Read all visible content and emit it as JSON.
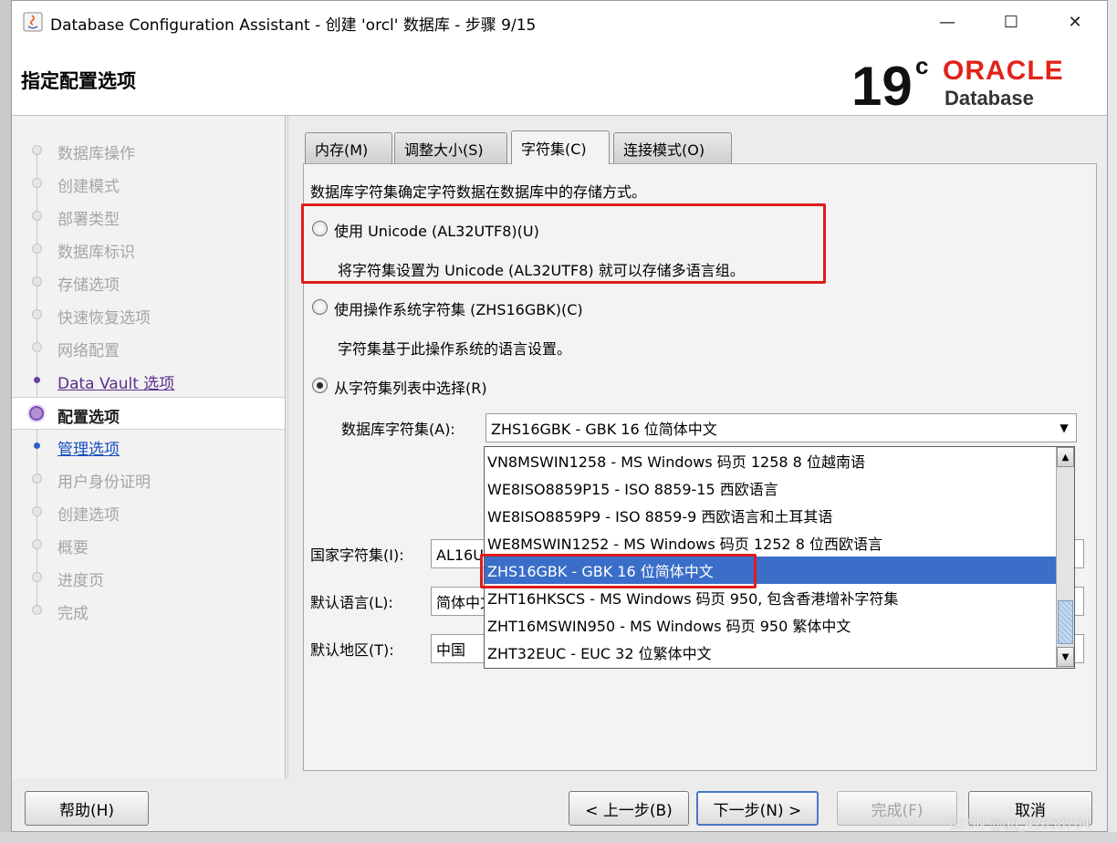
{
  "window": {
    "title": "Database Configuration Assistant - 创建 'orcl' 数据库 - 步骤 9/15",
    "controls": {
      "minimize": "—",
      "maximize": "☐",
      "close": "✕"
    }
  },
  "header": {
    "page_title": "指定配置选项",
    "logo": {
      "version": "19",
      "superscript": "c",
      "brand": "ORACLE",
      "product": "Database",
      "brand_color": "#e2231a"
    }
  },
  "nav": {
    "items": [
      {
        "label": "数据库操作",
        "state": "pending"
      },
      {
        "label": "创建模式",
        "state": "pending"
      },
      {
        "label": "部署类型",
        "state": "pending"
      },
      {
        "label": "数据库标识",
        "state": "pending"
      },
      {
        "label": "存储选项",
        "state": "pending"
      },
      {
        "label": "快速恢复选项",
        "state": "pending"
      },
      {
        "label": "网络配置",
        "state": "pending"
      },
      {
        "label": "Data Vault 选项",
        "state": "visited"
      },
      {
        "label": "配置选项",
        "state": "current"
      },
      {
        "label": "管理选项",
        "state": "next"
      },
      {
        "label": "用户身份证明",
        "state": "pending"
      },
      {
        "label": "创建选项",
        "state": "pending"
      },
      {
        "label": "概要",
        "state": "pending"
      },
      {
        "label": "进度页",
        "state": "pending"
      },
      {
        "label": "完成",
        "state": "pending"
      }
    ]
  },
  "tabs": [
    {
      "label": "内存(M)",
      "selected": false
    },
    {
      "label": "调整大小(S)",
      "selected": false
    },
    {
      "label": "字符集(C)",
      "selected": true
    },
    {
      "label": "连接模式(O)",
      "selected": false
    }
  ],
  "charset": {
    "intro": "数据库字符集确定字符数据在数据库中的存储方式。",
    "option_unicode": {
      "label": "使用 Unicode (AL32UTF8)(U)",
      "desc": "将字符集设置为 Unicode (AL32UTF8) 就可以存储多语言组。",
      "checked": false
    },
    "option_os": {
      "label": "使用操作系统字符集 (ZHS16GBK)(C)",
      "desc": "字符集基于此操作系统的语言设置。",
      "checked": false
    },
    "option_list": {
      "label": "从字符集列表中选择(R)",
      "checked": true
    },
    "db_charset_label": "数据库字符集(A):",
    "db_charset_value": "ZHS16GBK - GBK 16 位简体中文",
    "national_label": "国家字符集(I):",
    "national_value": "AL16UTF16 - Unicode UTF-16 通用字符集",
    "language_label": "默认语言(L):",
    "language_value": "简体中文",
    "territory_label": "默认地区(T):",
    "territory_value": "中国",
    "dropdown_options": [
      {
        "text": "VN8MSWIN1258 - MS Windows 码页 1258 8 位越南语",
        "selected": false
      },
      {
        "text": "WE8ISO8859P15 - ISO 8859-15 西欧语言",
        "selected": false
      },
      {
        "text": "WE8ISO8859P9 - ISO 8859-9 西欧语言和土耳其语",
        "selected": false
      },
      {
        "text": "WE8MSWIN1252 - MS Windows 码页 1252 8 位西欧语言",
        "selected": false
      },
      {
        "text": "ZHS16GBK - GBK 16 位简体中文",
        "selected": true
      },
      {
        "text": "ZHT16HKSCS - MS Windows 码页 950, 包含香港增补字符集",
        "selected": false
      },
      {
        "text": "ZHT16MSWIN950 - MS Windows 码页 950 繁体中文",
        "selected": false
      },
      {
        "text": "ZHT32EUC - EUC 32 位繁体中文",
        "selected": false
      }
    ]
  },
  "buttons": {
    "help": "帮助(H)",
    "back": "< 上一步(B)",
    "next": "下一步(N) >",
    "finish": "完成(F)",
    "cancel": "取消"
  },
  "watermark": "CSDN @qq_42658764",
  "colors": {
    "highlight_box": "#e01b1b",
    "selection": "#3a6ec8",
    "nav_visited": "#5a2d8a",
    "nav_next": "#1a4fbf"
  }
}
